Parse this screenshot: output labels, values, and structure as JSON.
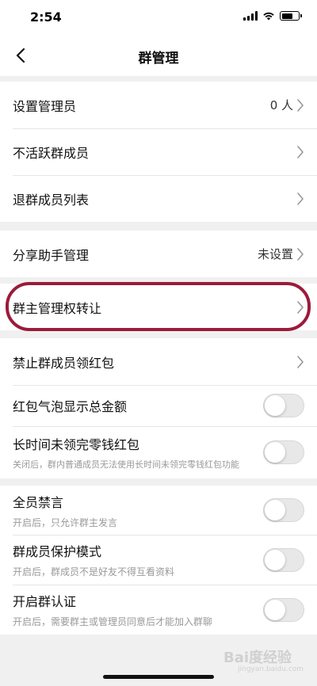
{
  "status_bar": {
    "time": "2:54",
    "battery_level": 0.65
  },
  "nav": {
    "title": "群管理",
    "back_icon": "chevron-left-icon"
  },
  "section1": [
    {
      "label": "设置管理员",
      "value": "0 人"
    },
    {
      "label": "不活跃群成员",
      "value": ""
    },
    {
      "label": "退群成员列表",
      "value": ""
    }
  ],
  "section2": [
    {
      "label": "分享助手管理",
      "value": "未设置"
    }
  ],
  "section3": [
    {
      "label": "群主管理权转让"
    }
  ],
  "section4": {
    "redpacket_ban": {
      "label": "禁止群成员领红包"
    },
    "bubble_total": {
      "label": "红包气泡显示总金额",
      "on": false
    },
    "unclaimed": {
      "label": "长时间未领完零钱红包",
      "sub": "关闭后，群内普通成员无法使用长时间未领完零钱红包功能",
      "on": false
    }
  },
  "section5": {
    "mute_all": {
      "label": "全员禁言",
      "sub": "开启后，只允许群主发言",
      "on": false
    },
    "protect": {
      "label": "群成员保护模式",
      "sub": "开启后，群成员不是好友不得互看资料",
      "on": false
    },
    "verify": {
      "label": "开启群认证",
      "sub": "开启后，需要群主或管理员同意后才能加入群聊",
      "on": false
    }
  },
  "watermark": {
    "brand": "Bai度经验",
    "url": "jingyan.baidu.com"
  },
  "colors": {
    "highlight": "#9b1b3a",
    "toggle_off": "#e8e8e8"
  }
}
